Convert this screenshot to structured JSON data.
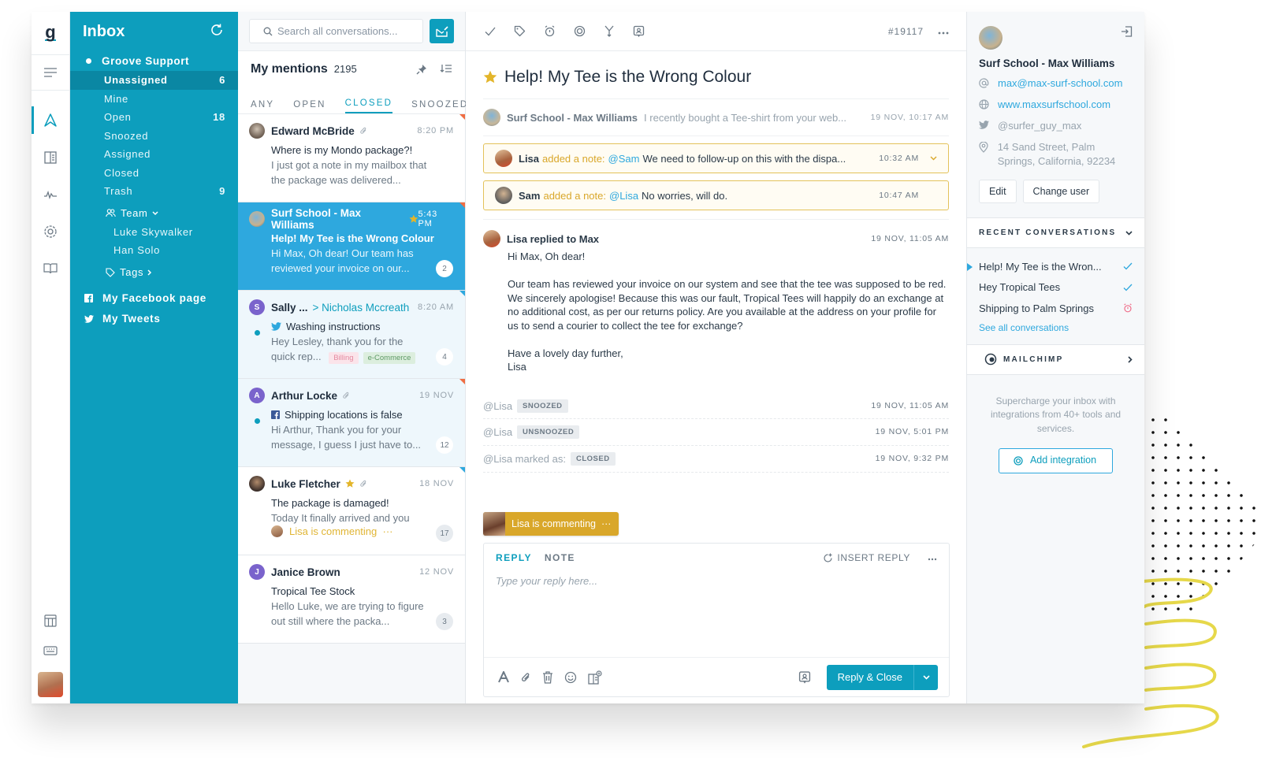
{
  "rail": {
    "logo": "g",
    "icons": [
      "menu-icon",
      "conversations-icon",
      "knowledge-base-icon",
      "reports-icon",
      "settings-icon",
      "docs-icon"
    ],
    "bottom_icons": [
      "widgets-icon",
      "keyboard-icon",
      "user-avatar"
    ]
  },
  "folders": {
    "title": "Inbox",
    "mailbox": "Groove Support",
    "items": [
      {
        "label": "Unassigned",
        "count": "6",
        "active": true
      },
      {
        "label": "Mine",
        "count": ""
      },
      {
        "label": "Open",
        "count": "18"
      },
      {
        "label": "Snoozed",
        "count": ""
      },
      {
        "label": "Assigned",
        "count": ""
      },
      {
        "label": "Closed",
        "count": ""
      },
      {
        "label": "Trash",
        "count": "9"
      }
    ],
    "team_label": "Team",
    "team_members": [
      "Luke Skywalker",
      "Han Solo"
    ],
    "tags_label": "Tags",
    "channels": [
      {
        "label": "My Facebook page",
        "icon": "facebook-icon"
      },
      {
        "label": "My Tweets",
        "icon": "twitter-icon"
      }
    ]
  },
  "list": {
    "search_placeholder": "Search all conversations...",
    "title": "My mentions",
    "count": "2195",
    "tabs": [
      "ANY",
      "OPEN",
      "CLOSED",
      "SNOOZED"
    ],
    "active_tab": "CLOSED",
    "conversations": [
      {
        "name": "Edward McBride",
        "time": "8:20 PM",
        "subject": "Where is my Mondo package?!",
        "preview": "I just got a note in my mailbox that the package was delivered...",
        "attachment": true
      },
      {
        "name": "Surf School - Max Williams",
        "time": "5:43 PM",
        "subject": "Help! My Tee is the Wrong Colour",
        "preview": "Hi Max, Oh dear! Our team has reviewed your invoice on our...",
        "starred": true,
        "count": "2"
      },
      {
        "name": "Sally ...",
        "assignee": "Nicholas Mccreath",
        "initial": "S",
        "time": "8:20 AM",
        "subject": "Washing instructions",
        "preview": "Hey Lesley, thank you for the quick rep...",
        "tags": [
          "Billing",
          "e-Commerce"
        ],
        "count": "4"
      },
      {
        "name": "Arthur Locke",
        "initial": "A",
        "time": "19 NOV",
        "subject": "Shipping locations is false",
        "preview": "Hi Arthur, Thank you for your message, I guess I just have to...",
        "attachment": true,
        "count": "12"
      },
      {
        "name": "Luke Fletcher",
        "time": "18 NOV",
        "subject": "The package is damaged!",
        "preview": "Today It finally arrived and you",
        "commenting": "Lisa is commenting",
        "starred": true,
        "attachment": true,
        "count": "17"
      },
      {
        "name": "Janice Brown",
        "initial": "J",
        "time": "12 NOV",
        "subject": "Tropical Tee Stock",
        "preview": "Hello Luke, we are trying to figure out still where the packa...",
        "count": "3"
      }
    ]
  },
  "main": {
    "ticket_number": "#19117",
    "title": "Help! My Tee is the Wrong Colour",
    "first_message": {
      "from": "Surf School - Max Williams",
      "snippet": "I recently bought a Tee-shirt from your web...",
      "time": "19 NOV, 10:17 AM"
    },
    "notes": [
      {
        "author": "Lisa",
        "action": "added a note:",
        "mention": "@Sam",
        "text": "We need to follow-up on this with the dispa...",
        "time": "10:32 AM"
      },
      {
        "author": "Sam",
        "action": "added a note:",
        "mention": "@Lisa",
        "text": "No worries, will do.",
        "time": "10:47 AM"
      }
    ],
    "reply": {
      "header": "Lisa replied to Max",
      "time": "19 NOV, 11:05 AM",
      "paragraphs": [
        "Hi Max, Oh dear!",
        "Our team has reviewed your invoice on our system and see that the tee was supposed to be red. We sincerely apologise! Because this was our fault, Tropical Tees will happily do an exchange at no additional cost, as per our returns policy. Are you available at the address on your profile for us to send a courier to collect the tee for exchange?",
        "Have a lovely day further,",
        "Lisa"
      ]
    },
    "events": [
      {
        "actor": "@Lisa",
        "label": "",
        "status": "SNOOZED",
        "time": "19 NOV, 11:05 AM"
      },
      {
        "actor": "@Lisa",
        "label": "",
        "status": "UNSNOOZED",
        "time": "19 NOV, 5:01 PM"
      },
      {
        "actor": "@Lisa",
        "label": "marked as:",
        "status": "CLOSED",
        "time": "19 NOV, 9:32 PM"
      }
    ],
    "commenting": "Lisa is commenting",
    "composer": {
      "tabs": [
        "REPLY",
        "NOTE"
      ],
      "active_tab": "REPLY",
      "insert_reply": "INSERT REPLY",
      "placeholder": "Type your reply here...",
      "send_label": "Reply & Close"
    }
  },
  "contact": {
    "name": "Surf School - Max Williams",
    "email": "max@max-surf-school.com",
    "website": "www.maxsurfschool.com",
    "twitter": "@surfer_guy_max",
    "address": "14 Sand Street, Palm Springs, California, 92234",
    "edit_label": "Edit",
    "change_user_label": "Change user",
    "recent_title": "RECENT CONVERSATIONS",
    "recent": [
      {
        "title": "Help! My Tee is the Wron...",
        "status": "closed"
      },
      {
        "title": "Hey Tropical Tees",
        "status": "closed"
      },
      {
        "title": "Shipping to Palm Springs",
        "status": "snoozed"
      }
    ],
    "see_all": "See all conversations",
    "integration": "MAILCHIMP",
    "promo": "Supercharge your inbox with integrations from 40+ tools and services.",
    "add_integration": "Add integration"
  },
  "colors": {
    "brand": "#0d9ebd",
    "selected": "#2ea8de",
    "note": "#d9a72a",
    "accent_red": "#f06d43"
  }
}
